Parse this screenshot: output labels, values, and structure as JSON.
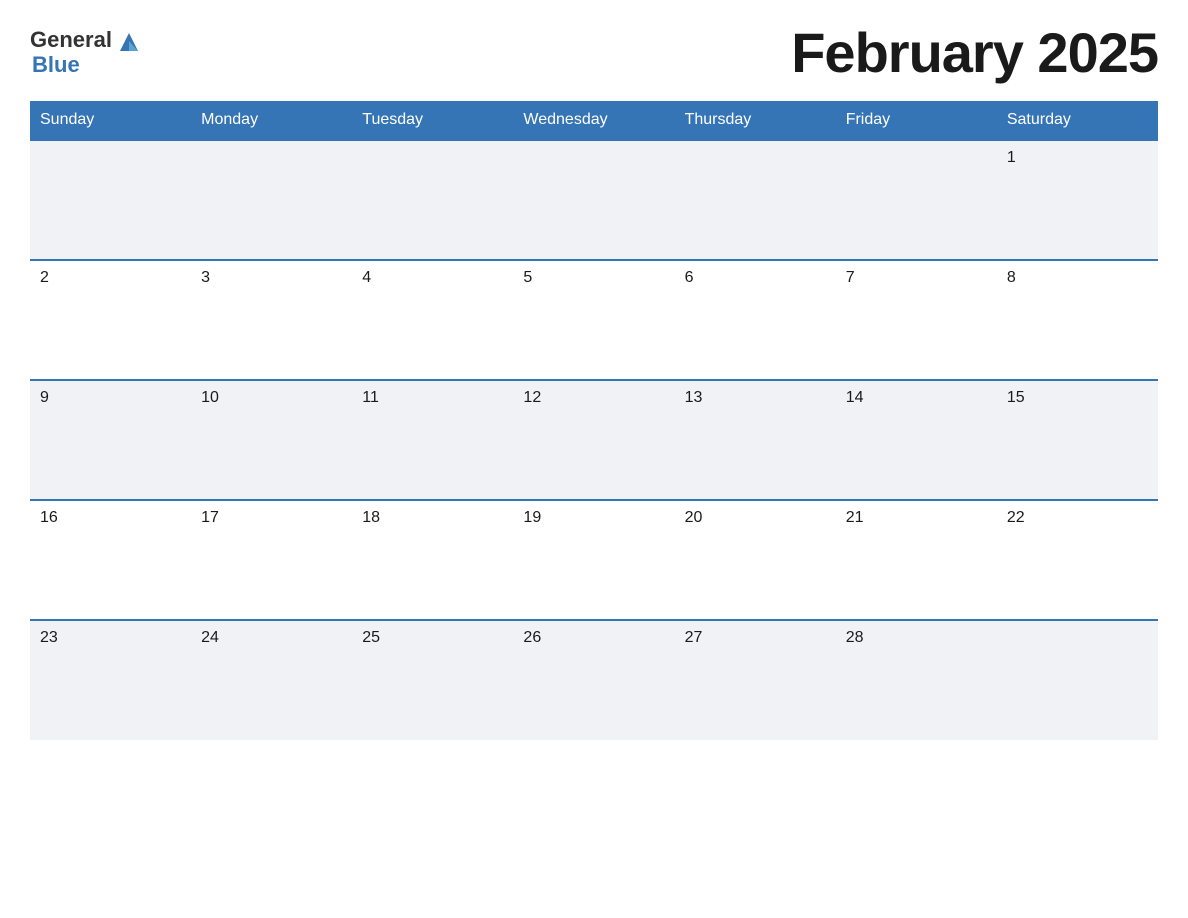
{
  "header": {
    "title": "February 2025",
    "logo": {
      "general": "General",
      "blue": "Blue"
    }
  },
  "calendar": {
    "weekdays": [
      "Sunday",
      "Monday",
      "Tuesday",
      "Wednesday",
      "Thursday",
      "Friday",
      "Saturday"
    ],
    "weeks": [
      [
        {
          "day": "",
          "empty": true
        },
        {
          "day": "",
          "empty": true
        },
        {
          "day": "",
          "empty": true
        },
        {
          "day": "",
          "empty": true
        },
        {
          "day": "",
          "empty": true
        },
        {
          "day": "",
          "empty": true
        },
        {
          "day": "1",
          "empty": false
        }
      ],
      [
        {
          "day": "2",
          "empty": false
        },
        {
          "day": "3",
          "empty": false
        },
        {
          "day": "4",
          "empty": false
        },
        {
          "day": "5",
          "empty": false
        },
        {
          "day": "6",
          "empty": false
        },
        {
          "day": "7",
          "empty": false
        },
        {
          "day": "8",
          "empty": false
        }
      ],
      [
        {
          "day": "9",
          "empty": false
        },
        {
          "day": "10",
          "empty": false
        },
        {
          "day": "11",
          "empty": false
        },
        {
          "day": "12",
          "empty": false
        },
        {
          "day": "13",
          "empty": false
        },
        {
          "day": "14",
          "empty": false
        },
        {
          "day": "15",
          "empty": false
        }
      ],
      [
        {
          "day": "16",
          "empty": false
        },
        {
          "day": "17",
          "empty": false
        },
        {
          "day": "18",
          "empty": false
        },
        {
          "day": "19",
          "empty": false
        },
        {
          "day": "20",
          "empty": false
        },
        {
          "day": "21",
          "empty": false
        },
        {
          "day": "22",
          "empty": false
        }
      ],
      [
        {
          "day": "23",
          "empty": false
        },
        {
          "day": "24",
          "empty": false
        },
        {
          "day": "25",
          "empty": false
        },
        {
          "day": "26",
          "empty": false
        },
        {
          "day": "27",
          "empty": false
        },
        {
          "day": "28",
          "empty": false
        },
        {
          "day": "",
          "empty": true
        }
      ]
    ]
  }
}
